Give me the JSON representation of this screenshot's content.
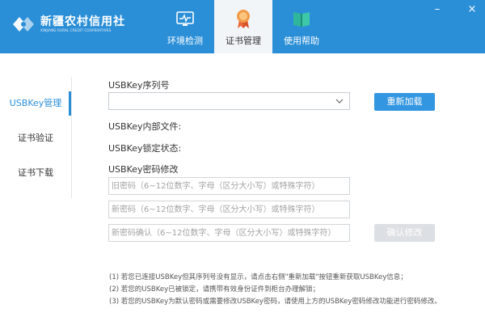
{
  "brand": {
    "name_cn": "新疆农村信用社",
    "name_en": "XINJIANG RURAL CREDIT COOPERATIVES"
  },
  "nav": {
    "tabs": [
      {
        "label": "环境检测",
        "icon": "monitor-pulse-icon",
        "active": false
      },
      {
        "label": "证书管理",
        "icon": "certificate-medal-icon",
        "active": true
      },
      {
        "label": "使用帮助",
        "icon": "help-book-icon",
        "active": false
      }
    ]
  },
  "window": {
    "minimize": "–",
    "close": "×"
  },
  "sidebar": {
    "items": [
      {
        "label": "USBKey管理",
        "active": true
      },
      {
        "label": "证书验证",
        "active": false
      },
      {
        "label": "证书下载",
        "active": false
      }
    ]
  },
  "main": {
    "serial_label": "USBKey序列号",
    "serial_value": "",
    "reload_button": "重新加载",
    "internal_file_label": "USBKey内部文件:",
    "lock_status_label": "USBKey锁定状态:",
    "pwd_section_label": "USBKey密码修改",
    "old_pwd_placeholder": "旧密码（6~12位数字、字母（区分大小写）或特殊字符）",
    "new_pwd_placeholder": "新密码（6~12位数字、字母（区分大小写）或特殊字符）",
    "confirm_pwd_placeholder": "新密码确认（6~12位数字、字母（区分大小写）或特殊字符）",
    "confirm_button": "确认修改"
  },
  "notes": [
    "(1) 若您已连接USBKey但其序列号没有显示，请点击右侧\"重新加载\"按钮重新获取USBKey信息；",
    "(2) 若您的USBKey已被锁定，请携带有效身份证件到柜台办理解锁；",
    "(3) 若您的USBKey为默认密码或需要修改USBKey密码，请使用上方的USBKey密码修改功能进行密码修改。"
  ],
  "colors": {
    "header": "#2b8fd8",
    "accent": "#2b8fd8",
    "button": "#3396e0",
    "button_disabled": "#dcdfe3"
  }
}
